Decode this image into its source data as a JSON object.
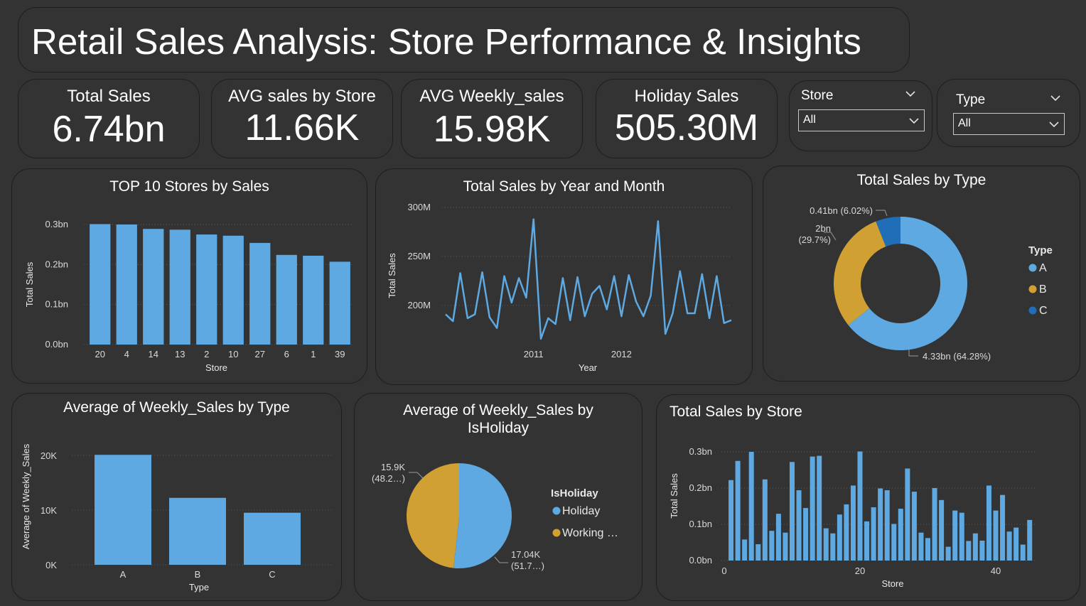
{
  "header": {
    "title": "Retail Sales Analysis: Store Performance & Insights"
  },
  "kpis": [
    {
      "label": "Total Sales",
      "value": "6.74bn"
    },
    {
      "label": "AVG sales by Store",
      "value": "11.66K"
    },
    {
      "label": "AVG Weekly_sales",
      "value": "15.98K"
    },
    {
      "label": "Holiday Sales",
      "value": "505.30M"
    }
  ],
  "slicers": {
    "store": {
      "title": "Store",
      "value": "All"
    },
    "type": {
      "title": "Type",
      "value": "All"
    }
  },
  "colors": {
    "blue": "#5ea9e1",
    "gold": "#d1a032",
    "darkblue": "#1f6eb7",
    "background": "#333333"
  },
  "chart_data": [
    {
      "type": "bar",
      "title": "TOP 10 Stores by Sales",
      "xlabel": "Store",
      "ylabel": "Total Sales",
      "categories": [
        "20",
        "4",
        "14",
        "13",
        "2",
        "10",
        "27",
        "6",
        "1",
        "39"
      ],
      "values": [
        0.301,
        0.3,
        0.289,
        0.287,
        0.275,
        0.272,
        0.254,
        0.224,
        0.222,
        0.207
      ],
      "ylim": [
        0,
        0.3
      ],
      "yticks": [
        "0.0bn",
        "0.1bn",
        "0.2bn",
        "0.3bn"
      ],
      "grid": true
    },
    {
      "type": "line",
      "title": "Total Sales by Year and Month",
      "xlabel": "Year",
      "ylabel": "Total Sales",
      "xticks": [
        "2011",
        "2012"
      ],
      "yticks": [
        "200M",
        "250M",
        "300M"
      ],
      "ylim": [
        165,
        300
      ],
      "values": [
        191,
        184,
        233,
        187,
        191,
        234,
        188,
        177,
        230,
        203,
        228,
        208,
        288,
        166,
        187,
        181,
        228,
        185,
        229,
        189,
        212,
        220,
        196,
        230,
        189,
        231,
        204,
        189,
        210,
        286,
        171,
        192,
        235,
        192,
        192,
        232,
        187,
        230,
        182,
        185
      ],
      "grid": true
    },
    {
      "type": "pie",
      "title": "Total Sales by Type",
      "legend_title": "Type",
      "donut": true,
      "slices": [
        {
          "name": "A",
          "value": 64.28,
          "label": "4.33bn (64.28%)",
          "color": "#5ea9e1"
        },
        {
          "name": "B",
          "value": 29.7,
          "label": "2bn\n(29.7%)",
          "color": "#d1a032"
        },
        {
          "name": "C",
          "value": 6.02,
          "label": "0.41bn (6.02%)",
          "color": "#1f6eb7"
        }
      ],
      "legend_placement": "right"
    },
    {
      "type": "bar",
      "title": "Average of Weekly_Sales by Type",
      "xlabel": "Type",
      "ylabel": "Average of Weekly_Sales",
      "categories": [
        "A",
        "B",
        "C"
      ],
      "values": [
        20100,
        12240,
        9520
      ],
      "ylim": [
        0,
        20000
      ],
      "yticks": [
        "0K",
        "10K",
        "20K"
      ],
      "grid": true
    },
    {
      "type": "pie",
      "title": "Average of Weekly_Sales by IsHoliday",
      "legend_title": "IsHoliday",
      "slices": [
        {
          "name": "Holiday",
          "value": 51.7,
          "label": "17.04K\n(51.7…)",
          "color": "#5ea9e1"
        },
        {
          "name": "Working …",
          "value": 48.3,
          "label": "15.9K\n(48.2…)",
          "color": "#d1a032"
        }
      ],
      "legend_placement": "right"
    },
    {
      "type": "bar",
      "title": "Total Sales by Store",
      "xlabel": "Store",
      "ylabel": "Total Sales",
      "x": [
        1,
        2,
        3,
        4,
        5,
        6,
        7,
        8,
        9,
        10,
        11,
        12,
        13,
        14,
        15,
        16,
        17,
        18,
        19,
        20,
        21,
        22,
        23,
        24,
        25,
        26,
        27,
        28,
        29,
        30,
        31,
        32,
        33,
        34,
        35,
        36,
        37,
        38,
        39,
        40,
        41,
        42,
        43,
        44,
        45
      ],
      "values": [
        0.222,
        0.275,
        0.058,
        0.3,
        0.045,
        0.224,
        0.082,
        0.129,
        0.077,
        0.272,
        0.194,
        0.145,
        0.287,
        0.289,
        0.089,
        0.075,
        0.127,
        0.155,
        0.207,
        0.301,
        0.108,
        0.147,
        0.199,
        0.194,
        0.101,
        0.143,
        0.254,
        0.19,
        0.077,
        0.062,
        0.2,
        0.167,
        0.038,
        0.138,
        0.132,
        0.054,
        0.075,
        0.055,
        0.207,
        0.138,
        0.181,
        0.08,
        0.091,
        0.044,
        0.112
      ],
      "ylim": [
        0,
        0.3
      ],
      "xticks": [
        "0",
        "20",
        "40"
      ],
      "yticks": [
        "0.0bn",
        "0.1bn",
        "0.2bn",
        "0.3bn"
      ],
      "grid": true
    }
  ]
}
